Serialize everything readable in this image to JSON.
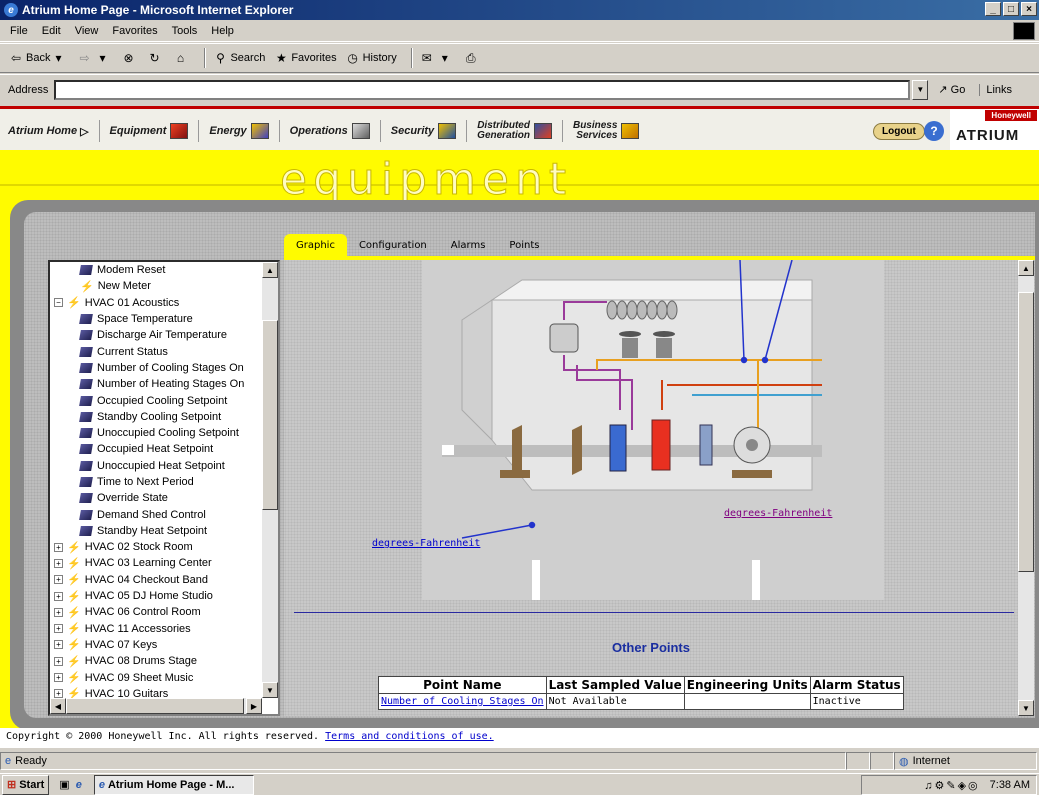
{
  "window": {
    "title": "Atrium Home Page - Microsoft Internet Explorer",
    "controls": [
      "_",
      "□",
      "×"
    ]
  },
  "menu": [
    "File",
    "Edit",
    "View",
    "Favorites",
    "Tools",
    "Help"
  ],
  "toolbar": {
    "back": "Back",
    "search": "Search",
    "favorites": "Favorites",
    "history": "History"
  },
  "address": {
    "label": "Address",
    "value": "",
    "go": "Go",
    "links": "Links"
  },
  "nav": {
    "items": [
      {
        "label": "Atrium Home",
        "icon": "play-arrow-icon"
      },
      {
        "label": "Equipment",
        "icon": "equipment-icon",
        "color": "#d04020"
      },
      {
        "label": "Energy",
        "icon": "energy-icon",
        "color": "#4040c0"
      },
      {
        "label": "Operations",
        "icon": "operations-icon",
        "color": "#606060"
      },
      {
        "label": "Security",
        "icon": "security-icon",
        "color": "#2050a0"
      },
      {
        "label1": "Distributed",
        "label2": "Generation",
        "icon": "generation-icon",
        "color": "#3050a0"
      },
      {
        "label1": "Business",
        "label2": "Services",
        "icon": "services-icon",
        "color": "#c07000"
      }
    ],
    "logout": "Logout",
    "help": "?",
    "brand": {
      "company": "Honeywell",
      "product": "ATRIUM"
    }
  },
  "banner": {
    "title": "equipment"
  },
  "tabs": [
    "Graphic",
    "Configuration",
    "Alarms",
    "Points"
  ],
  "active_tab": "Graphic",
  "tree": {
    "items": [
      {
        "label": "Modem Reset",
        "type": "point",
        "depth": 1
      },
      {
        "label": "New Meter",
        "type": "device",
        "depth": 1
      },
      {
        "label": "HVAC 01 Acoustics",
        "type": "device",
        "depth": 0,
        "expander": "−"
      },
      {
        "label": "Space Temperature",
        "type": "point",
        "depth": 1
      },
      {
        "label": "Discharge Air Temperature",
        "type": "point",
        "depth": 1
      },
      {
        "label": "Current Status",
        "type": "point",
        "depth": 1
      },
      {
        "label": "Number of Cooling Stages On",
        "type": "point",
        "depth": 1
      },
      {
        "label": "Number of Heating Stages On",
        "type": "point",
        "depth": 1
      },
      {
        "label": "Occupied Cooling Setpoint",
        "type": "point",
        "depth": 1
      },
      {
        "label": "Standby Cooling Setpoint",
        "type": "point",
        "depth": 1
      },
      {
        "label": "Unoccupied Cooling Setpoint",
        "type": "point",
        "depth": 1
      },
      {
        "label": "Occupied Heat Setpoint",
        "type": "point",
        "depth": 1
      },
      {
        "label": "Unoccupied Heat Setpoint",
        "type": "point",
        "depth": 1
      },
      {
        "label": "Time to Next Period",
        "type": "point",
        "depth": 1
      },
      {
        "label": "Override State",
        "type": "point",
        "depth": 1
      },
      {
        "label": "Demand Shed Control",
        "type": "point",
        "depth": 1
      },
      {
        "label": "Standby Heat Setpoint",
        "type": "point",
        "depth": 1
      },
      {
        "label": "HVAC 02 Stock Room",
        "type": "device",
        "depth": 0,
        "expander": "+"
      },
      {
        "label": "HVAC 03 Learning Center",
        "type": "device",
        "depth": 0,
        "expander": "+"
      },
      {
        "label": "HVAC 04 Checkout Band",
        "type": "device",
        "depth": 0,
        "expander": "+"
      },
      {
        "label": "HVAC 05 DJ Home Studio",
        "type": "device",
        "depth": 0,
        "expander": "+"
      },
      {
        "label": "HVAC 06 Control Room",
        "type": "device",
        "depth": 0,
        "expander": "+"
      },
      {
        "label": "HVAC 11 Accessories",
        "type": "device",
        "depth": 0,
        "expander": "+"
      },
      {
        "label": "HVAC 07 Keys",
        "type": "device",
        "depth": 0,
        "expander": "+"
      },
      {
        "label": "HVAC 08 Drums Stage",
        "type": "device",
        "depth": 0,
        "expander": "+"
      },
      {
        "label": "HVAC 09 Sheet Music",
        "type": "device",
        "depth": 0,
        "expander": "+"
      },
      {
        "label": "HVAC 10 Guitars",
        "type": "device",
        "depth": 0,
        "expander": "+"
      }
    ]
  },
  "diagram": {
    "link_right": "degrees-Fahrenheit",
    "link_left": "degrees-Fahrenheit"
  },
  "other_points": {
    "title": "Other Points",
    "columns": [
      "Point Name",
      "Last Sampled Value",
      "Engineering Units",
      "Alarm Status"
    ],
    "rows": [
      {
        "name": "Number of Cooling Stages On",
        "value": "Not Available",
        "units": "",
        "alarm": "Inactive"
      }
    ]
  },
  "footer": {
    "copyright": "Copyright © 2000 Honeywell Inc. All rights reserved.",
    "terms": "Terms and conditions of use."
  },
  "status": {
    "text": "Ready",
    "zone": "Internet"
  },
  "taskbar": {
    "start": "Start",
    "task": "Atrium Home Page - M...",
    "clock": "7:38 AM"
  }
}
